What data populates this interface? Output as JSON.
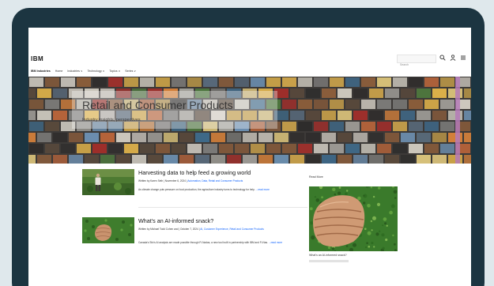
{
  "masthead": {
    "logo": "IBM",
    "search_placeholder": "Search",
    "icons": [
      "search-icon",
      "user-icon",
      "menu-icon"
    ]
  },
  "subnav": {
    "brand": "IBM Industries",
    "items": [
      "Home",
      "Industries ∨",
      "Technology ∨",
      "Topics ∨",
      "Series ∨"
    ]
  },
  "hero": {
    "title": "Retail and Consumer Products",
    "subtitle": "Industry insights, perspectives"
  },
  "articles": [
    {
      "title": "Harvesting data to help feed a growing world",
      "meta_prefix": "Written by Karen Seth | November 6, 2024 | ",
      "meta_tags": "Automation, Data, Retail and Consumer Products",
      "desc_text": "As climate change puts pressure on food production, the agriculture industry turns to technology for help.",
      "read_more": "...read more"
    },
    {
      "title": "What's an AI-informed snack?",
      "meta_prefix": "Written by Michael Todd Cohen and | October 7, 2024 | ",
      "meta_tags": "AI, Customer Experience, Retail and Consumer Products",
      "desc_text": "Canada's Stix's AI analysis are made possible through Fi-Nadas, a new tool built in partnership with IBM and Fi-Nas.",
      "read_more": "...read more"
    }
  ],
  "sidebar": {
    "heading": "Read More",
    "caption": "What's an AI-informed snack?"
  },
  "colors": {
    "bezel": "#1c3541",
    "background": "#dfe8ec",
    "link": "#0f62fe",
    "hero_accent": "#b57ab8"
  }
}
